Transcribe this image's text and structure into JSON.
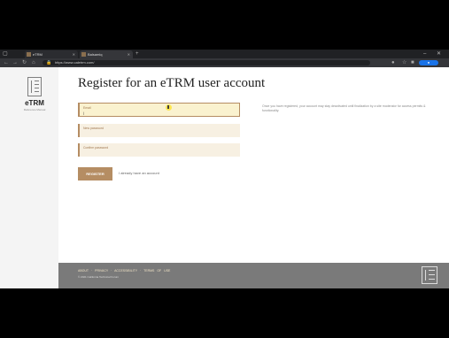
{
  "browser": {
    "tabs": [
      {
        "label": "eTRM"
      },
      {
        "label": "Balsamiq"
      }
    ],
    "new_tab": "+",
    "window_controls": "–  ✕",
    "url": "https://www.caletrm.com/"
  },
  "sidebar": {
    "logo_text": "eTRM",
    "logo_subtitle": "Reference Manual"
  },
  "main": {
    "title": "Register for an eTRM user account",
    "email_label": "Email",
    "password_label": "New password",
    "confirm_label": "Confirm password",
    "register_label": "REGISTER",
    "already_link": "I already have an account",
    "info_text": "Once you have registered, your account may stay deactivated until finalization by a site moderator for access permits & functionality."
  },
  "footer": {
    "links": "ABOUT · PRIVACY · ACCESSIBILITY · TERMS OF USE",
    "copyright": "© 2021 California Technical Forum"
  },
  "colors": {
    "accent": "#b58d63",
    "active_field": "#faf2cf",
    "footer": "#7a7a7a"
  }
}
